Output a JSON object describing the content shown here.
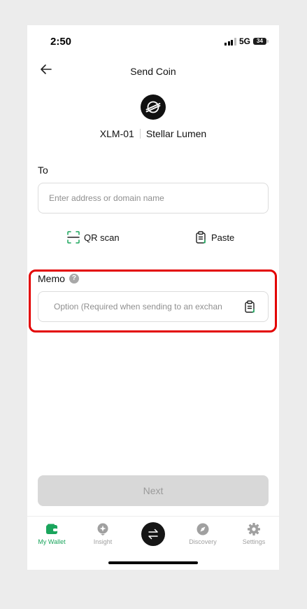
{
  "status_bar": {
    "time": "2:50",
    "network": "5G",
    "battery": "34"
  },
  "header": {
    "title": "Send Coin"
  },
  "coin": {
    "symbol": "XLM-01",
    "name": "Stellar Lumen"
  },
  "to": {
    "label": "To",
    "placeholder": "Enter address or domain name",
    "value": ""
  },
  "actions": {
    "qr_scan": "QR scan",
    "paste": "Paste"
  },
  "memo": {
    "label": "Memo",
    "help": "?",
    "placeholder": "Option (Required when sending to an exchan",
    "value": ""
  },
  "next_button": "Next",
  "tabs": [
    {
      "label": "My Wallet",
      "icon": "wallet-icon",
      "active": true
    },
    {
      "label": "Insight",
      "icon": "insight-icon",
      "active": false
    },
    {
      "label": "",
      "icon": "swap-icon",
      "active": false
    },
    {
      "label": "Discovery",
      "icon": "compass-icon",
      "active": false
    },
    {
      "label": "Settings",
      "icon": "gear-icon",
      "active": false
    }
  ],
  "colors": {
    "accent": "#1aa55c",
    "highlight": "#e30000",
    "disabled_button": "#d8d8d8"
  }
}
